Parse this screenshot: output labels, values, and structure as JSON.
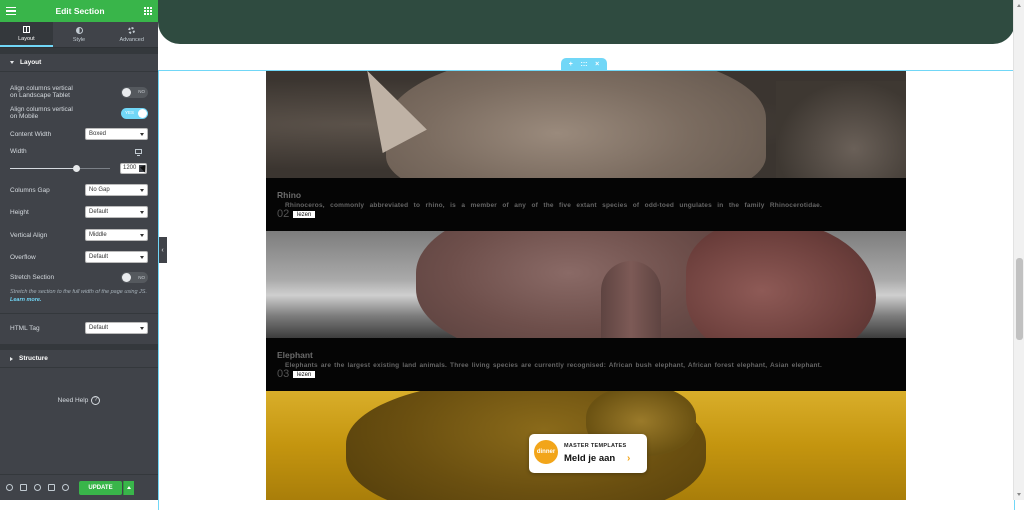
{
  "sidebar": {
    "title": "Edit Section",
    "tabs": [
      {
        "label": "Layout",
        "icon": "layout-icon"
      },
      {
        "label": "Style",
        "icon": "style-icon"
      },
      {
        "label": "Advanced",
        "icon": "gear-icon"
      }
    ],
    "layout_section": "Layout",
    "controls": {
      "align_tablet_l1": "Align columns vertical",
      "align_tablet_l2": "on Landscape Tablet",
      "align_tablet_toggle": "NO",
      "align_mobile_l1": "Align columns vertical",
      "align_mobile_l2": "on Mobile",
      "align_mobile_toggle": "YES",
      "content_width_label": "Content Width",
      "content_width_value": "Boxed",
      "width_label": "Width",
      "width_value": "1200",
      "width_slider_fraction": 0.66,
      "columns_gap_label": "Columns Gap",
      "columns_gap_value": "No Gap",
      "height_label": "Height",
      "height_value": "Default",
      "vertical_align_label": "Vertical Align",
      "vertical_align_value": "Middle",
      "overflow_label": "Overflow",
      "overflow_value": "Default",
      "stretch_label": "Stretch Section",
      "stretch_toggle": "NO",
      "stretch_note": "Stretch the section to the full width of the page using JS.",
      "learn_more": "Learn more.",
      "html_tag_label": "HTML Tag",
      "html_tag_value": "Default"
    },
    "structure_section": "Structure",
    "need_help": "Need Help",
    "update_button": "UPDATE"
  },
  "canvas": {
    "section_handle": {
      "add": "+",
      "move": ":::",
      "close": "×"
    },
    "cards": [
      {
        "name": "Rhino",
        "number": "02",
        "description": "Rhinoceros, commonly abbreviated to rhino, is a member of any of the five extant species of odd-toed ungulates in the family Rhinocerotidae.",
        "button": "lezen"
      },
      {
        "name": "Elephant",
        "number": "03",
        "description": "Elephants are the largest existing land animals. Three living species are currently recognised: African bush elephant, African forest elephant, Asian elephant.",
        "button": "lezen"
      }
    ],
    "promo": {
      "badge": "dinner",
      "kicker": "MASTER TEMPLATES",
      "cta": "Meld je aan",
      "chevron": "›"
    }
  },
  "colors": {
    "editor_green": "#39b54a",
    "panel_bg": "#404349",
    "accent_blue": "#71d7f7",
    "header_band": "#2f4b40",
    "promo_orange": "#f2a51a"
  }
}
